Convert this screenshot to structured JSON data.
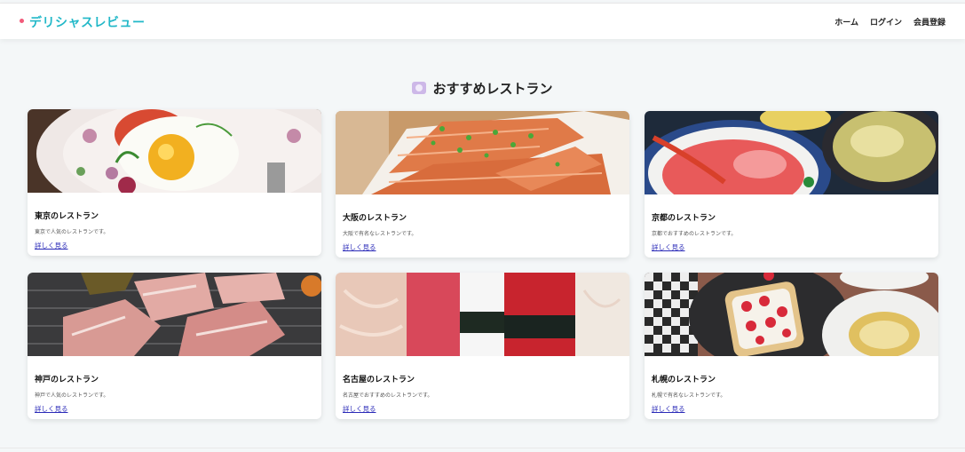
{
  "header": {
    "logo": "デリシャスレビュー",
    "nav": [
      {
        "label": "ホーム"
      },
      {
        "label": "ログイン"
      },
      {
        "label": "会員登録"
      }
    ]
  },
  "section": {
    "icon": "plate-icon",
    "title": "おすすめレストラン"
  },
  "restaurants": [
    {
      "name": "東京のレストラン",
      "description": "東京で人気のレストランです。",
      "link": "詳しく見る",
      "image": "fried-egg-plate"
    },
    {
      "name": "大阪のレストラン",
      "description": "大阪で有名なレストランです。",
      "link": "詳しく見る",
      "image": "grilled-salmon"
    },
    {
      "name": "京都のレストラン",
      "description": "京都でおすすめのレストランです。",
      "link": "詳しく見る",
      "image": "seafood-bowl-miso"
    },
    {
      "name": "神戸のレストラン",
      "description": "神戸で人気のレストランです。",
      "link": "詳しく見る",
      "image": "bbq-pork"
    },
    {
      "name": "名古屋のレストラン",
      "description": "名古屋でおすすめのレストランです。",
      "link": "詳しく見る",
      "image": "sushi"
    },
    {
      "name": "札幌のレストラン",
      "description": "札幌で有名なレストランです。",
      "link": "詳しく見る",
      "image": "strawberry-toast"
    }
  ],
  "colors": {
    "brand": "#22b8c8",
    "logo_dot": "#f25a7a",
    "link": "#2b2bb8",
    "background": "#f4f7f8"
  }
}
